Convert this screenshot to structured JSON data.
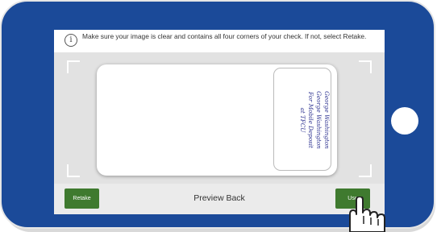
{
  "instruction": {
    "icon": "info-icon",
    "icon_glyph": "i",
    "text": "Make sure your image is clear and contains all four corners of your check. If not, select Retake."
  },
  "check": {
    "endorsement_lines": [
      "George Washington",
      "George Washington",
      "For Mobile Deposit",
      "at TFCU"
    ],
    "ink_color": "#2a2f8f"
  },
  "footer": {
    "retake_label": "Retake",
    "title": "Preview Back",
    "use_label": "Use"
  },
  "colors": {
    "phone_body": "#1b4a99",
    "button_green": "#3f7a2f",
    "capture_bg": "#e2e2e2"
  },
  "cursor": {
    "icon": "hand-pointer-icon"
  }
}
